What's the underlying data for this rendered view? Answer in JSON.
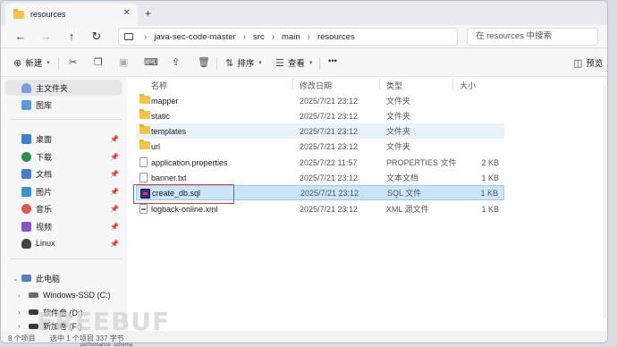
{
  "tab": {
    "title": "resources",
    "close": "✕",
    "add": "+"
  },
  "nav": {
    "back": "←",
    "forward": "→",
    "up": "↑",
    "refresh": "↻"
  },
  "breadcrumbs": [
    "java-sec-code-master",
    "src",
    "main",
    "resources"
  ],
  "breadcrumb_sep": "›",
  "search": {
    "placeholder": "在 resources 中搜索"
  },
  "toolbar": {
    "new_label": "新建",
    "sort_label": "排序",
    "view_label": "查看",
    "more_label": "•••",
    "preview_label": "预览"
  },
  "sidebar": {
    "home": "主文件夹",
    "gallery": "图库",
    "quick": [
      {
        "label": "桌面",
        "color": "#3f7fd1"
      },
      {
        "label": "下载",
        "color": "#2f8f4e"
      },
      {
        "label": "文档",
        "color": "#4a7cc9"
      },
      {
        "label": "图片",
        "color": "#3a93c9"
      },
      {
        "label": "音乐",
        "color": "#e0574f"
      },
      {
        "label": "视频",
        "color": "#8557c4"
      },
      {
        "label": "Linux",
        "color": "#444444"
      }
    ],
    "this_pc": "此电脑",
    "drives": [
      "Windows-SSD (C:)",
      "软件盘 (D:)",
      "新加卷 (F:)"
    ]
  },
  "columns": {
    "name": "名称",
    "date": "修改日期",
    "type": "类型",
    "size": "大小"
  },
  "files": [
    {
      "name": "mapper",
      "date": "2025/7/21 23:12",
      "type": "文件夹",
      "size": "",
      "icon": "folder"
    },
    {
      "name": "static",
      "date": "2025/7/21 23:12",
      "type": "文件夹",
      "size": "",
      "icon": "folder"
    },
    {
      "name": "templates",
      "date": "2025/7/21 23:12",
      "type": "文件夹",
      "size": "",
      "icon": "folder"
    },
    {
      "name": "url",
      "date": "2025/7/21 23:12",
      "type": "文件夹",
      "size": "",
      "icon": "folder"
    },
    {
      "name": "application.properties",
      "date": "2025/7/22 11:57",
      "type": "PROPERTIES 文件",
      "size": "2 KB",
      "icon": "doc"
    },
    {
      "name": "banner.txt",
      "date": "2025/7/21 23:12",
      "type": "文本文档",
      "size": "1 KB",
      "icon": "doc"
    },
    {
      "name": "create_db.sql",
      "date": "2025/7/21 23:12",
      "type": "SQL 文件",
      "size": "1 KB",
      "icon": "sql"
    },
    {
      "name": "logback-online.xml",
      "date": "2025/7/21 23:12",
      "type": "XML 源文件",
      "size": "1 KB",
      "icon": "xml"
    }
  ],
  "status": {
    "count": "8 个项目",
    "selected": "选中 1 个项目  337 字节"
  },
  "watermark": "FREEBUF",
  "below_window": "performance_schema"
}
